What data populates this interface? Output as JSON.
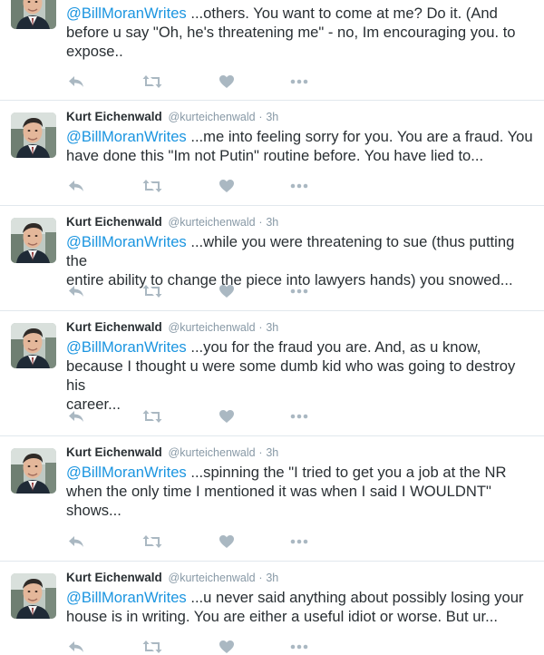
{
  "author": {
    "name": "Kurt Eichenwald",
    "handle": "@kurteichenwald",
    "separator": "·"
  },
  "icons": {
    "reply": "reply-icon",
    "retweet": "retweet-icon",
    "like": "heart-icon",
    "more": "more-icon"
  },
  "colors": {
    "mention": "#1b95e0",
    "meta": "#8899a6",
    "action": "#aab8c2",
    "divider": "#e1e8ed"
  },
  "tweets": [
    {
      "time": "",
      "mention": "@BillMoranWrites",
      "line1": " ...others. You want to come at me? Do it. (And",
      "line2": "before u say \"Oh, he's threatening me\" - no, Im encouraging you. to",
      "line3": "expose.."
    },
    {
      "time": "3h",
      "mention": "@BillMoranWrites",
      "line1": " ...me into feeling sorry for you. You are a fraud. You",
      "line2": "have done this \"Im not Putin\" routine before. You have lied to...",
      "line3": ""
    },
    {
      "time": "3h",
      "mention": "@BillMoranWrites",
      "line1": " ...while you were threatening to sue (thus putting the",
      "line2": "entire ability to change the piece into lawyers hands) you snowed...",
      "line3": ""
    },
    {
      "time": "3h",
      "mention": "@BillMoranWrites",
      "line1": " ...you for the fraud you are. And, as u know,",
      "line2": "because I thought u were some dumb kid who was going to destroy his",
      "line3": "career..."
    },
    {
      "time": "3h",
      "mention": "@BillMoranWrites",
      "line1": " ...spinning the \"I tried to get you a job at the NR",
      "line2": "when the only time I mentioned it was when I said I WOULDNT\"",
      "line3": "shows..."
    },
    {
      "time": "3h",
      "mention": "@BillMoranWrites",
      "line1": " ...u never said anything about possibly losing your",
      "line2": "house is in writing. You are either a useful idiot or worse. But ur...",
      "line3": ""
    }
  ]
}
